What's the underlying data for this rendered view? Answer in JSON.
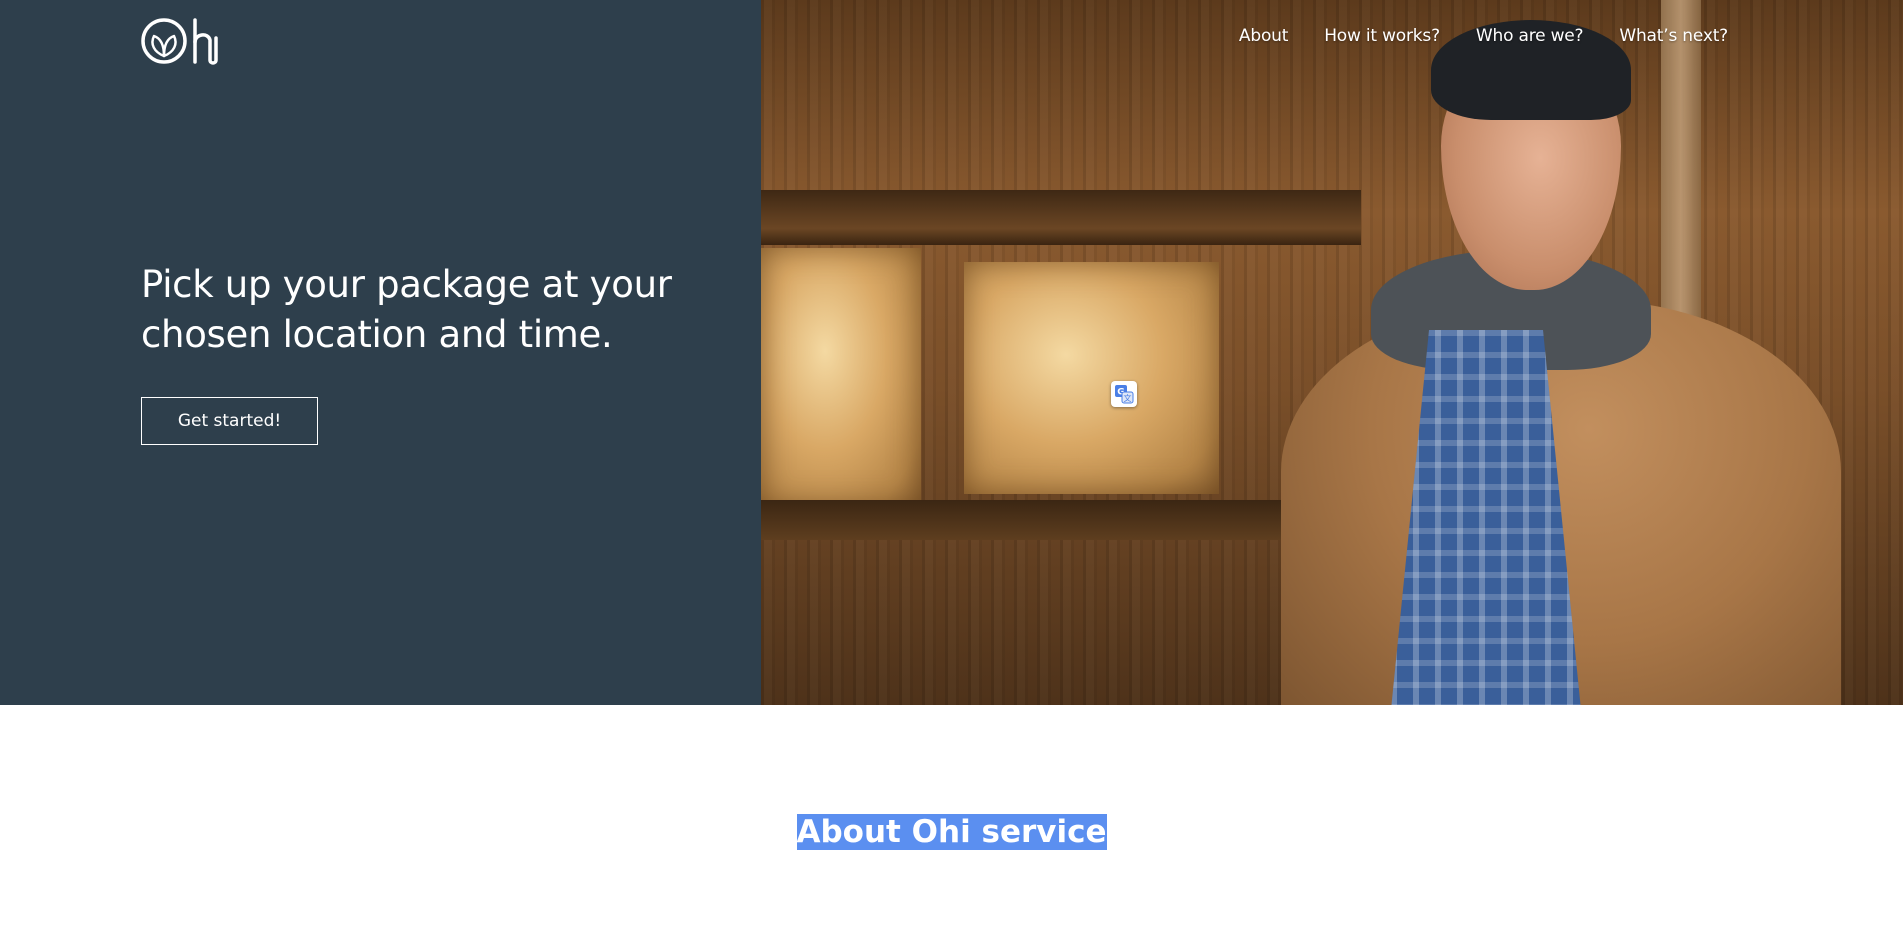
{
  "brand": {
    "logo_text": "Ohi",
    "logo_icon": "leaf-circle-icon"
  },
  "nav": {
    "items": [
      {
        "label": "About"
      },
      {
        "label": "How it works?"
      },
      {
        "label": "Who are we?"
      },
      {
        "label": "What’s next?"
      }
    ]
  },
  "hero": {
    "headline": "Pick up your package at your chosen location and time.",
    "cta_label": "Get started!",
    "background_color": "#2e3f4c",
    "image_alt": "Smiling man in a tan jacket and plaid shirt in a wooden cabin"
  },
  "translate_widget": {
    "icon": "translate-icon"
  },
  "about": {
    "title": "About Ohi service",
    "highlight_color": "#5b8ff0"
  }
}
